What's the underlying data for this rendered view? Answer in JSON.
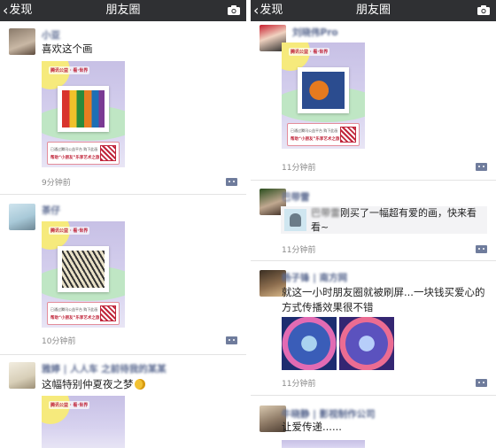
{
  "left": {
    "nav": {
      "back_label": "发现",
      "title": "朋友圈"
    },
    "posts": [
      {
        "name": "小亚",
        "text": "喜欢这个画",
        "time": "9分钟前"
      },
      {
        "name": "茶仔",
        "text": "",
        "time": "10分钟前"
      },
      {
        "name": "雅婷 | 人人车 之前待我的某某",
        "text": "这幅特别仲夏夜之梦",
        "time": ""
      }
    ]
  },
  "right": {
    "nav": {
      "back_label": "发现",
      "title": "朋友圈"
    },
    "posts": [
      {
        "name": "刘晓伟Pro",
        "text": "",
        "time": "11分钟前"
      },
      {
        "name": "巴带雷",
        "text": "",
        "time": "11分钟前",
        "share_name": "巴带雷",
        "share_text": "刚买了一幅超有爱的画，快来看看~"
      },
      {
        "name": "杨子锋 | 南方网",
        "text": "就这一小时朋友圈就被刷屏...一块钱买爱心的方式传播效果很不错",
        "time": "11分钟前"
      },
      {
        "name": "牛晓静 | 影视制作公司",
        "text": "让爱传递......",
        "time": ""
      }
    ]
  },
  "poster": {
    "logo_text": "腾讯公益 · 看·世界",
    "card_line1": "已通过腾讯公益平台   购下此画",
    "card_line2": "帮助“小朋友”乐享艺术之旅"
  },
  "colors": {
    "navbar_bg": "#2f3033",
    "name_color": "#5b6a91",
    "more_button": "#6f7c9c",
    "poster_bg": "#c7c0e5",
    "card_accent": "#c0253a"
  },
  "icons": {
    "back": "chevron-left-icon",
    "camera": "camera-icon",
    "more": "comment-more-icon"
  }
}
